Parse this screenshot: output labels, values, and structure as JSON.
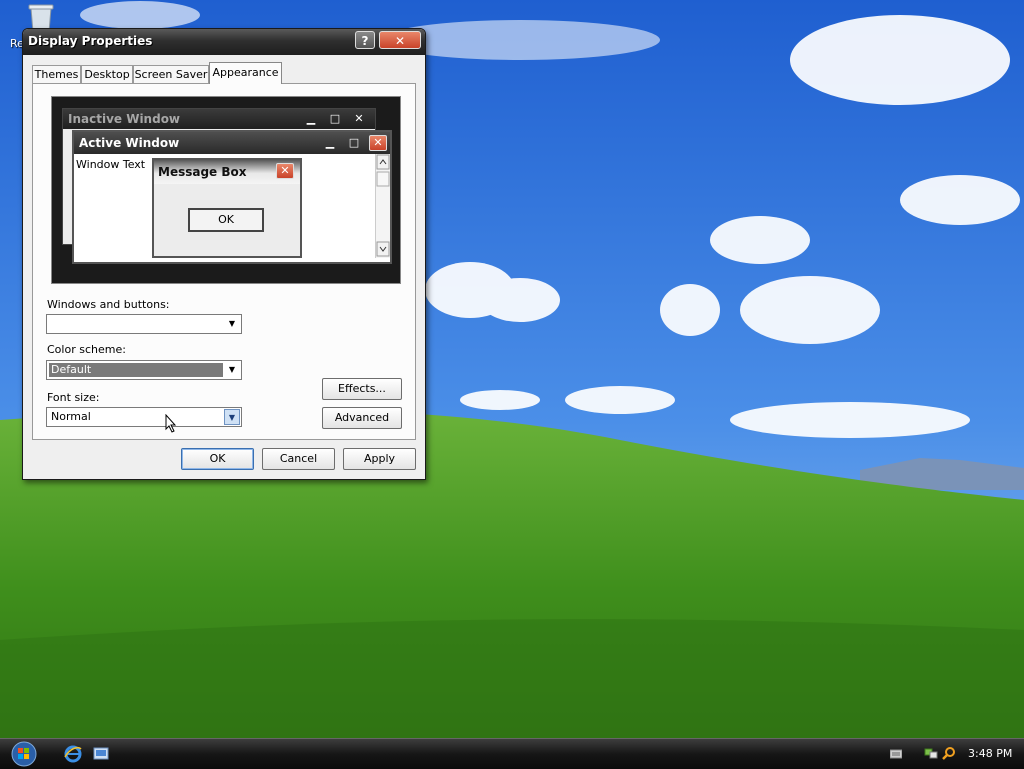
{
  "desktop": {
    "recycle_bin_label": "Re"
  },
  "window": {
    "title": "Display Properties",
    "help_glyph": "?",
    "close_glyph": "✕",
    "tabs": [
      {
        "label": "Themes"
      },
      {
        "label": "Desktop"
      },
      {
        "label": "Screen Saver"
      },
      {
        "label": "Appearance",
        "active": true
      }
    ]
  },
  "preview": {
    "inactive_title": "Inactive Window",
    "active_title": "Active Window",
    "window_text": "Window Text",
    "message_title": "Message Box",
    "message_ok": "OK",
    "minimize_glyph": "▁",
    "maximize_glyph": "□",
    "close_glyph": "✕"
  },
  "appearance": {
    "windows_buttons_label": "Windows and buttons:",
    "windows_buttons_value": "",
    "color_scheme_label": "Color scheme:",
    "color_scheme_value": "Default",
    "font_size_label": "Font size:",
    "font_size_value": "Normal",
    "effects_button": "Effects...",
    "advanced_button": "Advanced"
  },
  "dialog_buttons": {
    "ok": "OK",
    "cancel": "Cancel",
    "apply": "Apply"
  },
  "taskbar": {
    "clock": "3:48 PM"
  },
  "colors": {
    "titlebar": "#2f2f2f",
    "selection": "#7a7a7a",
    "sky": "#2b6fd8",
    "grass": "#4a9a1e"
  }
}
